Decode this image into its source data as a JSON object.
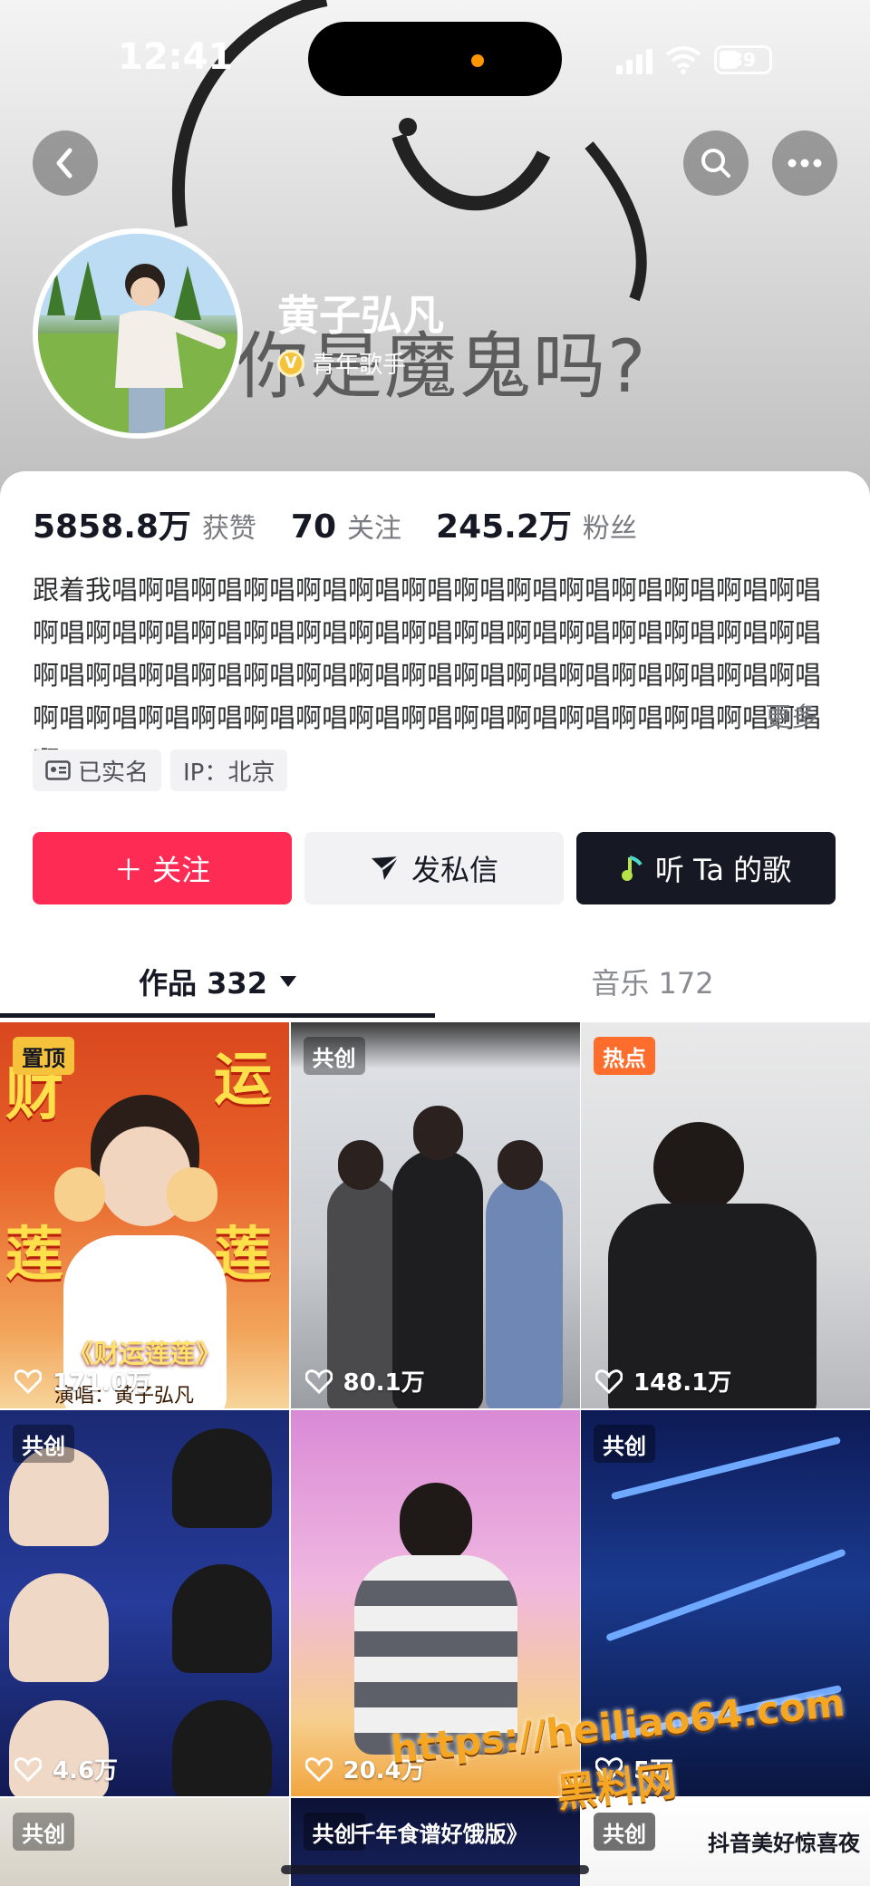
{
  "status_bar": {
    "time": "12:41",
    "battery": "39"
  },
  "header": {
    "cover_caption": "你是魔鬼吗?",
    "back_icon": "chevron-left-icon",
    "search_icon": "search-icon",
    "more_icon": "more-icon"
  },
  "profile": {
    "name": "黄子弘凡",
    "title": "青年歌手",
    "verified_icon": "verified-badge-icon",
    "stats": [
      {
        "value": "5858.8万",
        "label": "获赞"
      },
      {
        "value": "70",
        "label": "关注"
      },
      {
        "value": "245.2万",
        "label": "粉丝"
      }
    ],
    "bio": "跟着我唱啊唱啊唱啊唱啊唱啊唱啊唱啊唱啊唱啊唱啊唱啊唱啊唱啊唱啊唱啊唱啊唱啊唱啊唱啊唱啊唱啊唱啊唱啊唱啊唱啊唱啊唱啊唱啊唱啊唱啊唱啊唱啊唱啊唱啊唱啊唱啊唱啊唱啊唱啊唱啊唱啊唱啊唱啊唱啊唱啊唱啊唱啊唱啊唱啊唱啊唱啊唱啊唱啊唱啊唱啊唱啊唱啊唱啊唱啊...",
    "bio_more": "更多",
    "tags": [
      {
        "icon": "id-card-icon",
        "label": "已实名"
      },
      {
        "label": "IP：北京"
      }
    ]
  },
  "actions": {
    "follow": "＋ 关注",
    "message": "发私信",
    "music": "听 Ta 的歌"
  },
  "tabs": {
    "works": "作品 332",
    "music": "音乐 172"
  },
  "videos": [
    {
      "badge": "置顶",
      "likes": "171.0万",
      "poster_left": "财",
      "poster_right": "运",
      "poster_left2": "莲",
      "poster_right2": "莲",
      "caption": "《财运莲莲》",
      "subtitle": "演唱：黄子弘凡"
    },
    {
      "badge": "共创",
      "likes": "80.1万"
    },
    {
      "badge": "热点",
      "likes": "148.1万"
    },
    {
      "badge": "共创",
      "likes": "4.6万"
    },
    {
      "badge": "",
      "likes": "20.4万"
    },
    {
      "badge": "共创",
      "likes": "5万"
    },
    {
      "badge": "共创",
      "likes": ""
    },
    {
      "badge": "共创",
      "likes": "",
      "title": "千年食谱好饿版》"
    },
    {
      "badge": "共创",
      "likes": "",
      "title": "抖音美好惊喜夜"
    }
  ],
  "watermark": {
    "url": "https://heiliao64.com",
    "name": "黑料网"
  },
  "colors": {
    "accent": "#fe2c55",
    "dark_button": "#161823",
    "light_button": "#f2f2f4",
    "pin_badge": "#f6c23b",
    "hot_badge": "#fe6d2c"
  }
}
